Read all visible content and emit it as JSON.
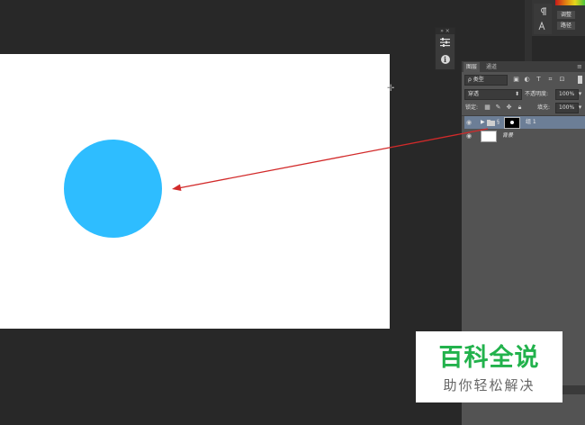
{
  "document": {
    "shape_color": "#2ebdff",
    "canvas_color": "#ffffff"
  },
  "mini_panel": {
    "collapse_label": "»",
    "close_label": "×",
    "adjust_icon": "sliders-icon",
    "info_icon_glyph": "i"
  },
  "right_panel": {
    "btn_adjust": "调整",
    "btn_paths": "路径"
  },
  "layers": {
    "tabs": [
      {
        "label": "图层",
        "active": true
      },
      {
        "label": "通道",
        "active": false
      }
    ],
    "filter_label": "ρ 类型",
    "blend_mode": "穿透",
    "opacity_label": "不透明度:",
    "opacity_value": "100%",
    "lock_label": "锁定:",
    "fill_label": "填充:",
    "fill_value": "100%",
    "items": [
      {
        "name": "组 1",
        "type": "group",
        "selected": true
      },
      {
        "name": "背景",
        "type": "background",
        "selected": false
      }
    ]
  },
  "watermark": {
    "title": "百科全说",
    "subtitle": "助你轻松解决",
    "title_color": "#22b24c"
  },
  "annotation": {
    "arrow_color": "#d22a2a"
  }
}
